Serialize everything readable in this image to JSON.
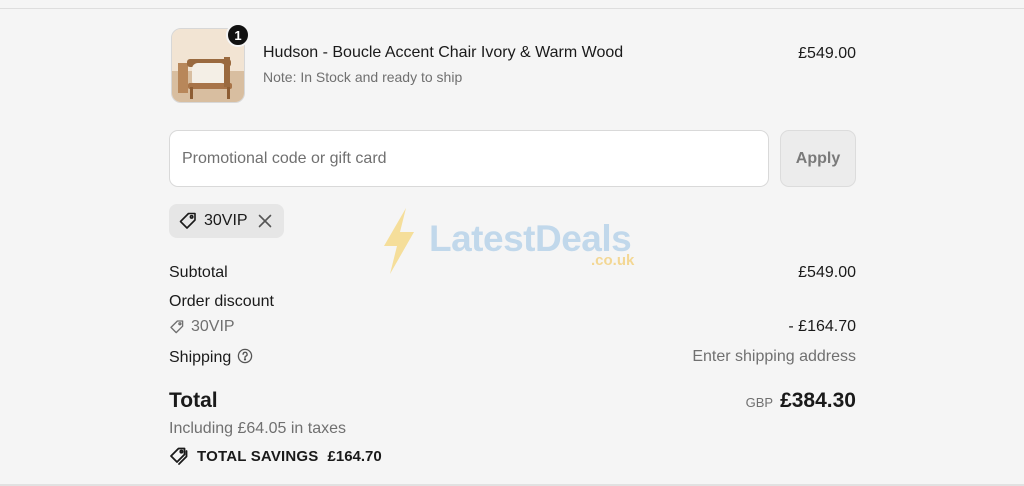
{
  "line_item": {
    "quantity": "1",
    "name": "Hudson - Boucle Accent Chair Ivory & Warm Wood",
    "note": "Note: In Stock and ready to ship",
    "price": "£549.00"
  },
  "promo": {
    "placeholder": "Promotional code or gift card",
    "value": "",
    "apply_label": "Apply"
  },
  "applied_discount": {
    "code": "30VIP"
  },
  "watermark": {
    "text": "LatestDeals",
    "sub": ".co.uk"
  },
  "summary": {
    "subtotal_label": "Subtotal",
    "subtotal_value": "£549.00",
    "order_discount_label": "Order discount",
    "discount_code": "30VIP",
    "discount_value": "- £164.70",
    "shipping_label": "Shipping",
    "shipping_value": "Enter shipping address",
    "total_label": "Total",
    "currency": "GBP",
    "total_value": "£384.30",
    "taxes_text": "Including £64.05 in taxes",
    "savings_label": "TOTAL SAVINGS",
    "savings_value": "£164.70"
  },
  "colors": {
    "background": "#f5f5f5",
    "text": "#1a1a1a",
    "muted": "#707070",
    "chip_background": "#e6e6e6"
  },
  "icons": [
    "tag-icon",
    "close-icon",
    "help-circle-icon",
    "savings-tag-icon",
    "lightning-icon"
  ]
}
